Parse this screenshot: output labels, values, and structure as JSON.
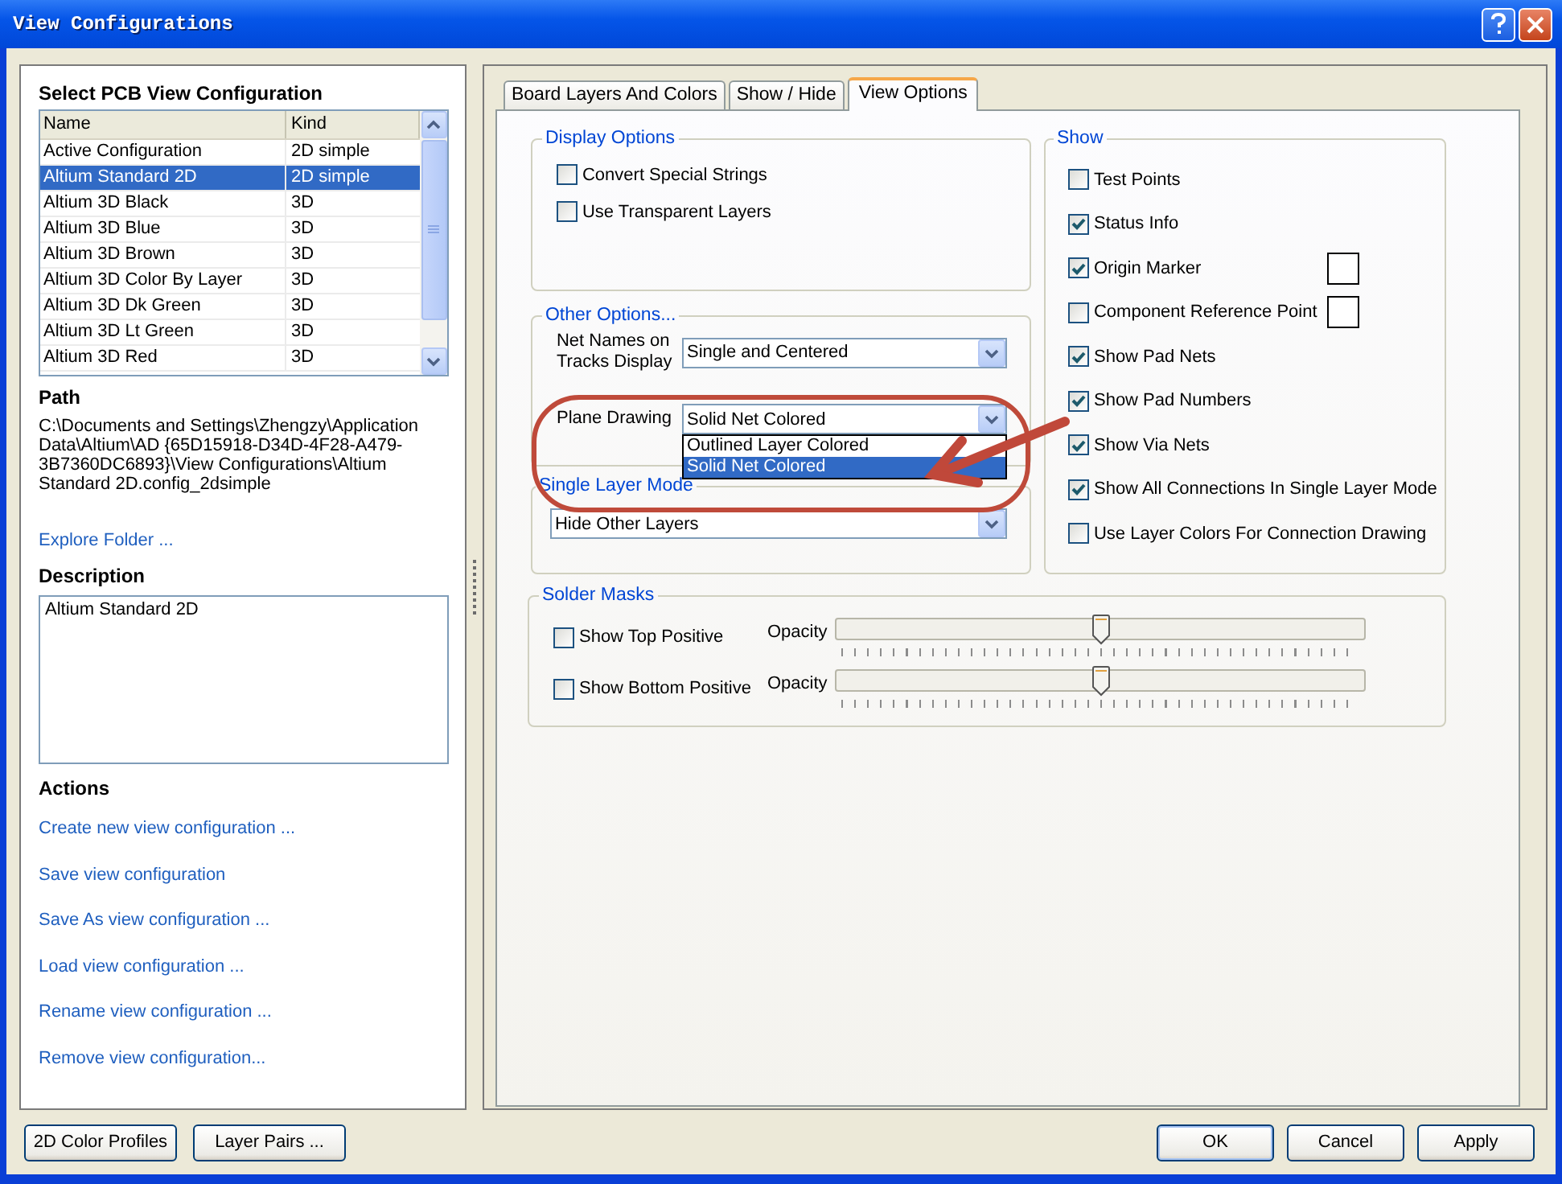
{
  "window": {
    "title": "View Configurations"
  },
  "left": {
    "heading": "Select PCB View Configuration",
    "columns": [
      "Name",
      "Kind"
    ],
    "rows": [
      {
        "name": "Active Configuration",
        "kind": "2D simple",
        "selected": false
      },
      {
        "name": "Altium Standard 2D",
        "kind": "2D simple",
        "selected": true
      },
      {
        "name": "Altium 3D Black",
        "kind": "3D",
        "selected": false
      },
      {
        "name": "Altium 3D Blue",
        "kind": "3D",
        "selected": false
      },
      {
        "name": "Altium 3D Brown",
        "kind": "3D",
        "selected": false
      },
      {
        "name": "Altium 3D Color By Layer",
        "kind": "3D",
        "selected": false
      },
      {
        "name": "Altium 3D Dk Green",
        "kind": "3D",
        "selected": false
      },
      {
        "name": "Altium 3D Lt Green",
        "kind": "3D",
        "selected": false
      },
      {
        "name": "Altium 3D Red",
        "kind": "3D",
        "selected": false
      }
    ],
    "path_label": "Path",
    "path": "C:\\Documents and Settings\\Zhengzy\\Application Data\\Altium\\AD {65D15918-D34D-4F28-A479-3B7360DC6893}\\View Configurations\\Altium Standard 2D.config_2dsimple",
    "explore_link": "Explore Folder ...",
    "description_label": "Description",
    "description": "Altium Standard 2D",
    "actions_label": "Actions",
    "actions": [
      "Create new view configuration ...",
      "Save view configuration",
      "Save As view configuration ...",
      "Load view configuration ...",
      "Rename view configuration ...",
      "Remove view configuration..."
    ]
  },
  "tabs": [
    {
      "label": "Board Layers And Colors",
      "selected": false
    },
    {
      "label": "Show / Hide",
      "selected": false
    },
    {
      "label": "View Options",
      "selected": true
    }
  ],
  "display_options": {
    "title": "Display Options",
    "items": [
      {
        "label": "Convert Special Strings",
        "checked": false
      },
      {
        "label": "Use Transparent Layers",
        "checked": false
      }
    ]
  },
  "other_options": {
    "title": "Other Options...",
    "net_names": {
      "label": "Net Names on Tracks Display",
      "value": "Single and Centered"
    },
    "plane_drawing": {
      "label": "Plane Drawing",
      "value": "Solid Net Colored",
      "expanded": true,
      "options": [
        {
          "label": "Outlined Layer Colored",
          "selected": false
        },
        {
          "label": "Solid Net Colored",
          "selected": true
        }
      ]
    }
  },
  "single_layer_mode": {
    "title": "Single Layer Mode",
    "value": "Hide Other Layers"
  },
  "show": {
    "title": "Show",
    "items": [
      {
        "label": "Test Points",
        "checked": false,
        "swatch": false
      },
      {
        "label": "Status Info",
        "checked": true,
        "swatch": false
      },
      {
        "label": "Origin Marker",
        "checked": true,
        "swatch": true
      },
      {
        "label": "Component Reference Point",
        "checked": false,
        "swatch": true
      },
      {
        "label": "Show Pad Nets",
        "checked": true,
        "swatch": false
      },
      {
        "label": "Show Pad Numbers",
        "checked": true,
        "swatch": false
      },
      {
        "label": "Show Via Nets",
        "checked": true,
        "swatch": false
      },
      {
        "label": "Show All  Connections In Single Layer Mode",
        "checked": true,
        "swatch": false
      },
      {
        "label": "Use Layer Colors For Connection Drawing",
        "checked": false,
        "swatch": false
      }
    ]
  },
  "solder_masks": {
    "title": "Solder Masks",
    "rows": [
      {
        "label": "Show Top Positive",
        "checked": false,
        "opacity_label": "Opacity",
        "level": 0.5
      },
      {
        "label": "Show Bottom Positive",
        "checked": false,
        "opacity_label": "Opacity",
        "level": 0.5
      }
    ]
  },
  "bottom_left_buttons": [
    {
      "label": "2D Color Profiles"
    },
    {
      "label": "Layer Pairs ..."
    }
  ],
  "bottom_right_buttons": [
    {
      "label": "OK",
      "default": true
    },
    {
      "label": "Cancel",
      "default": false
    },
    {
      "label": "Apply",
      "default": false
    }
  ]
}
